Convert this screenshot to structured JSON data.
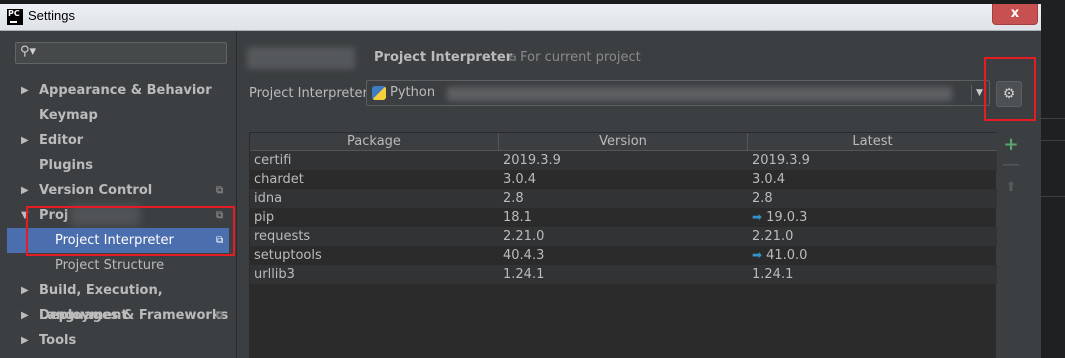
{
  "window": {
    "app_icon": "PC",
    "title": "Settings",
    "close_label": "x"
  },
  "sidebar": {
    "search_placeholder": "",
    "items": [
      {
        "label": "Appearance & Behavior",
        "arrow": "▶"
      },
      {
        "label": "Keymap"
      },
      {
        "label": "Editor",
        "arrow": "▶"
      },
      {
        "label": "Plugins"
      },
      {
        "label": "Version Control",
        "arrow": "▶"
      },
      {
        "label": "Proj",
        "arrow": "▼"
      },
      {
        "label": "Project Interpreter",
        "selected": true
      },
      {
        "label": "Project Structure"
      },
      {
        "label": "Build, Execution, Deployment",
        "arrow": "▶"
      },
      {
        "label": "Languages & Frameworks",
        "arrow": "▶"
      },
      {
        "label": "Tools",
        "arrow": "▶"
      }
    ]
  },
  "main": {
    "title": "Project Interpreter",
    "scope": "For current project",
    "interpreter_label": "Project Interpreter:",
    "interpreter_value": "Python",
    "table": {
      "columns": [
        "Package",
        "Version",
        "Latest"
      ],
      "rows": [
        {
          "package": "certifi",
          "version": "2019.3.9",
          "latest": "2019.3.9",
          "upgrade": false
        },
        {
          "package": "chardet",
          "version": "3.0.4",
          "latest": "3.0.4",
          "upgrade": false
        },
        {
          "package": "idna",
          "version": "2.8",
          "latest": "2.8",
          "upgrade": false
        },
        {
          "package": "pip",
          "version": "18.1",
          "latest": "19.0.3",
          "upgrade": true
        },
        {
          "package": "requests",
          "version": "2.21.0",
          "latest": "2.21.0",
          "upgrade": false
        },
        {
          "package": "setuptools",
          "version": "40.4.3",
          "latest": "41.0.0",
          "upgrade": true
        },
        {
          "package": "urllib3",
          "version": "1.24.1",
          "latest": "1.24.1",
          "upgrade": false
        }
      ]
    },
    "tools": {
      "add": "+",
      "remove": "—",
      "up": "⬆"
    }
  },
  "colors": {
    "accent": "#4b6eaf",
    "annotation": "#e51c23",
    "add": "#59a869",
    "upgrade": "#3592c4"
  }
}
